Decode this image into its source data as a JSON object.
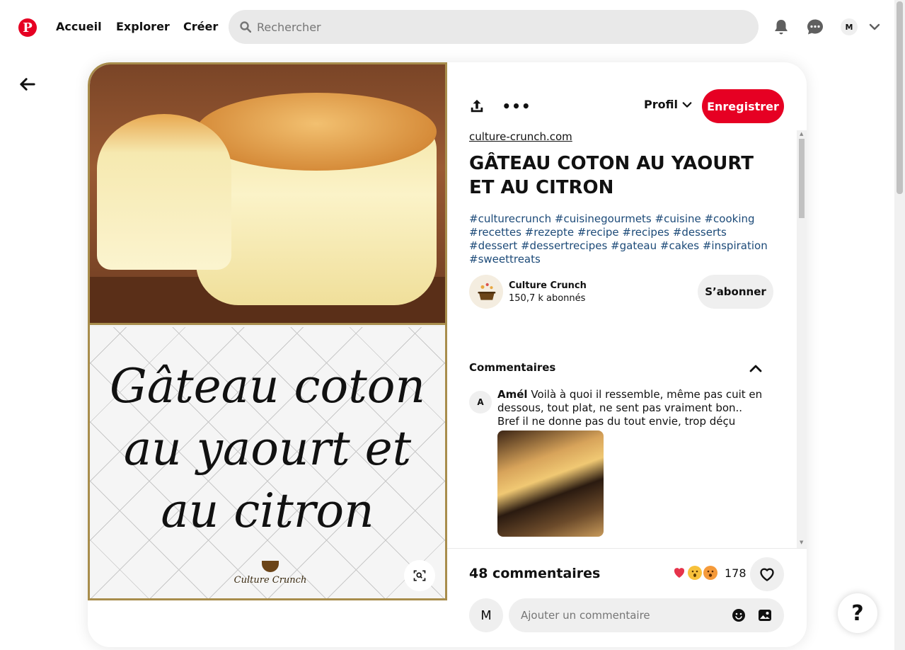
{
  "header": {
    "logo_letter": "P",
    "nav": [
      {
        "label": "Accueil"
      },
      {
        "label": "Explorer"
      },
      {
        "label": "Créer"
      }
    ],
    "search_placeholder": "Rechercher",
    "avatar_initial": "M",
    "icons": [
      "pinterest-logo",
      "search-icon",
      "bell-icon",
      "messages-icon",
      "chevron-down-icon"
    ]
  },
  "pin": {
    "image_text": "Gâteau coton\nau yaourt et\nau citron",
    "image_brand": "Culture Crunch",
    "actions": {
      "more_label": "•••",
      "profil_label": "Profil",
      "save_label": "Enregistrer"
    },
    "source_link": "culture-crunch.com",
    "title": "GÂTEAU COTON AU YAOURT ET AU CITRON",
    "hashtags": "#culturecrunch #cuisinegourmets #cuisine #cooking #recettes #rezepte #recipe #recipes #desserts #dessert #dessertrecipes #gateau #cakes #inspiration #sweettreats",
    "author": {
      "name": "Culture Crunch",
      "followers": "150,7 k abonnés",
      "follow_label": "S’abonner"
    }
  },
  "comments": {
    "heading": "Commentaires",
    "items": [
      {
        "avatar": "A",
        "author": "Amél",
        "text": "Voilà à quoi il ressemble, même pas cuit en dessous, tout plat, ne sent pas vraiment bon.. Bref il ne donne pas du tout envie, trop déçu"
      }
    ],
    "count_label": "48 commentaires",
    "reactions_count": "178",
    "input_placeholder": "Ajouter un commentaire",
    "my_avatar": "M"
  },
  "help_label": "?",
  "colors": {
    "brand_red": "#e60023",
    "hashtag_blue": "#1c4a78",
    "frame_gold": "#a88d4c"
  }
}
